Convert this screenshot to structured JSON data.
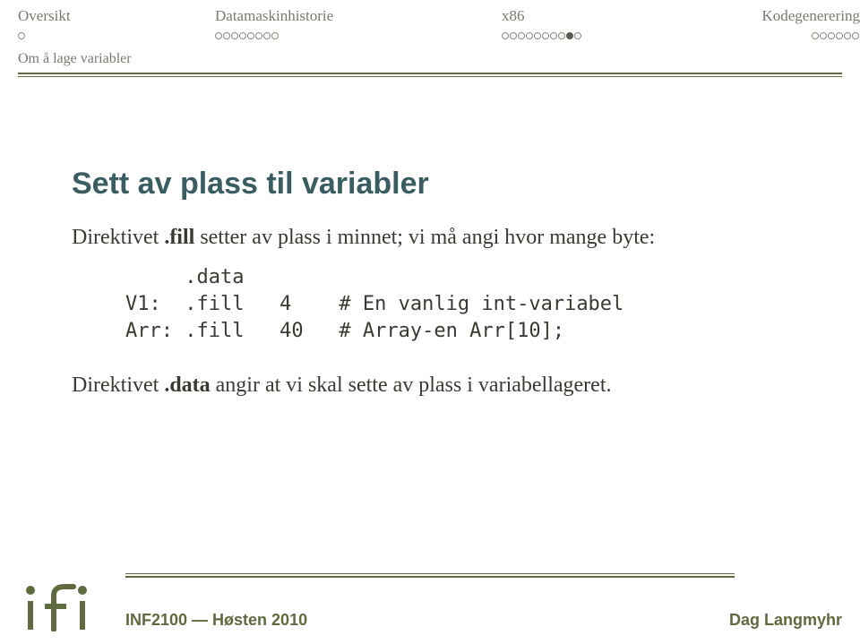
{
  "nav": {
    "items": [
      {
        "label": "Oversikt",
        "dots": 1,
        "filled": []
      },
      {
        "label": "Datamaskinhistorie",
        "dots": 8,
        "filled": []
      },
      {
        "label": "x86",
        "dots": 10,
        "filled": [
          8
        ]
      },
      {
        "label": "Kodegenerering",
        "dots": 6,
        "filled": []
      }
    ]
  },
  "section": "Om å lage variabler",
  "title": "Sett av plass til variabler",
  "para1_a": "Direktivet ",
  "para1_b": ".fill",
  "para1_c": " setter av plass i minnet; vi må angi hvor mange byte:",
  "code": "     .data\nV1:  .fill   4    # En vanlig int-variabel\nArr: .fill   40   # Array-en Arr[10];",
  "para2_a": "Direktivet ",
  "para2_b": ".data",
  "para2_c": " angir at vi skal sette av plass i variabellageret.",
  "footer": {
    "left": "INF2100 — Høsten 2010",
    "right": "Dag Langmyhr"
  }
}
